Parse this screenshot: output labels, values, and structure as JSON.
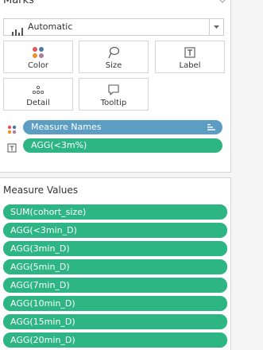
{
  "marks": {
    "title": "Marks",
    "mark_type": "Automatic",
    "tiles": [
      {
        "label": "Color"
      },
      {
        "label": "Size"
      },
      {
        "label": "Label"
      },
      {
        "label": "Detail"
      },
      {
        "label": "Tooltip"
      }
    ],
    "pills": [
      {
        "label": "Measure Names",
        "role": "color",
        "color": "#5b9dc3"
      },
      {
        "label": "AGG(<3m%)",
        "role": "label",
        "color": "#2db584"
      }
    ]
  },
  "measure_values": {
    "title": "Measure Values",
    "items": [
      "SUM(cohort_size)",
      "AGG(<3min_D)",
      "AGG(3min_D)",
      "AGG(5min_D)",
      "AGG(7min_D)",
      "AGG(10min_D)",
      "AGG(15min_D)",
      "AGG(20min_D)"
    ],
    "pill_color": "#2db584"
  },
  "colors": {
    "measure_pill": "#2db584",
    "dimension_pill": "#5b9dc3"
  }
}
